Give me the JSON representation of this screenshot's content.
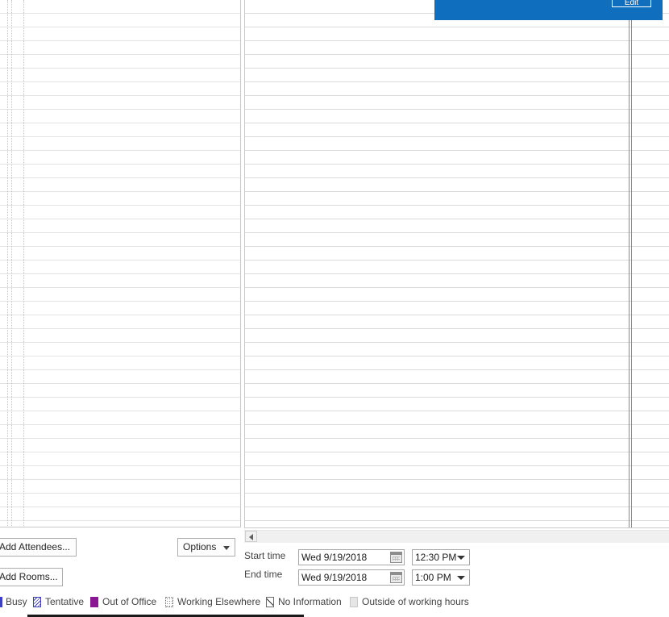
{
  "toast": {
    "button_label": "Edit"
  },
  "buttons": {
    "add_attendees": "Add Attendees...",
    "add_rooms": "Add Rooms...",
    "options": "Options"
  },
  "time": {
    "start_label": "Start time",
    "end_label": "End time",
    "start_date": "Wed 9/19/2018",
    "end_date": "Wed 9/19/2018",
    "start_time": "12:30 PM",
    "end_time": "1:00 PM"
  },
  "legend": {
    "busy": "Busy",
    "tentative": "Tentative",
    "out_of_office": "Out of Office",
    "working_elsewhere": "Working Elsewhere",
    "no_information": "No Information",
    "outside_working_hours": "Outside of working hours"
  },
  "colors": {
    "accent_blue": "#106ebe",
    "busy": "#3d3fc1",
    "out_of_office": "#8b1893"
  }
}
